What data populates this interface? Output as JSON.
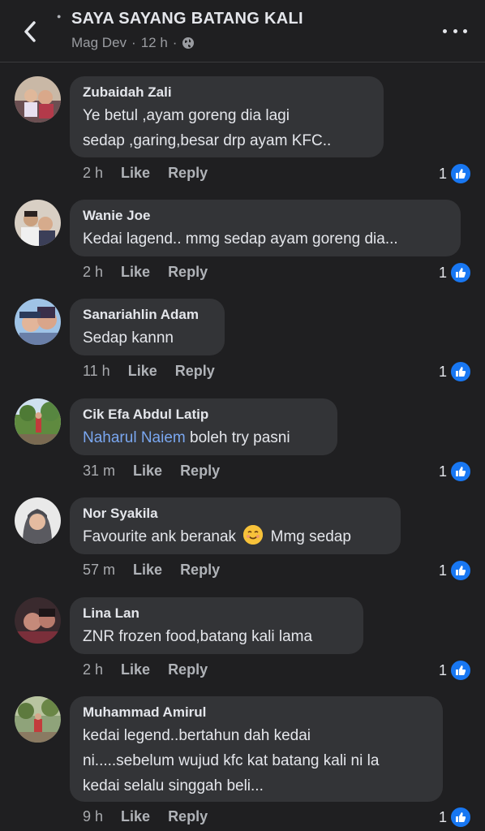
{
  "header": {
    "title": "SAYA SAYANG BATANG KALI",
    "author": "Mag Dev",
    "dot": "·",
    "time": "12 h",
    "dot2": "·"
  },
  "actions": {
    "like": "Like",
    "reply": "Reply"
  },
  "comments": [
    {
      "name": "Zubaidah Zali",
      "lines": [
        "Ye betul ,ayam goreng dia lagi",
        "sedap ,garing,besar drp ayam KFC.."
      ],
      "time": "2 h",
      "likes": "1"
    },
    {
      "name": "Wanie Joe",
      "lines": [
        "Kedai lagend.. mmg sedap ayam goreng dia..."
      ],
      "time": "2 h",
      "likes": "1"
    },
    {
      "name": "Sanariahlin Adam",
      "lines": [
        "Sedap kannn"
      ],
      "time": "11 h",
      "likes": "1"
    },
    {
      "name": "Cik Efa Abdul Latip",
      "mention": "Naharul Naiem",
      "lines": [
        " boleh try pasni"
      ],
      "time": "31 m",
      "likes": "1"
    },
    {
      "name": "Nor Syakila",
      "lines": [
        "Favourite ank beranak",
        "Mmg sedap"
      ],
      "time": "57 m",
      "likes": "1"
    },
    {
      "name": "Lina Lan",
      "lines": [
        "ZNR frozen food,batang kali lama"
      ],
      "time": "2 h",
      "likes": "1"
    },
    {
      "name": "Muhammad Amirul",
      "lines": [
        "kedai legend..bertahun dah kedai",
        "ni.....sebelum wujud kfc kat batang kali ni la",
        "kedai selalu singgah beli..."
      ],
      "time": "9 h",
      "likes": "1"
    }
  ]
}
